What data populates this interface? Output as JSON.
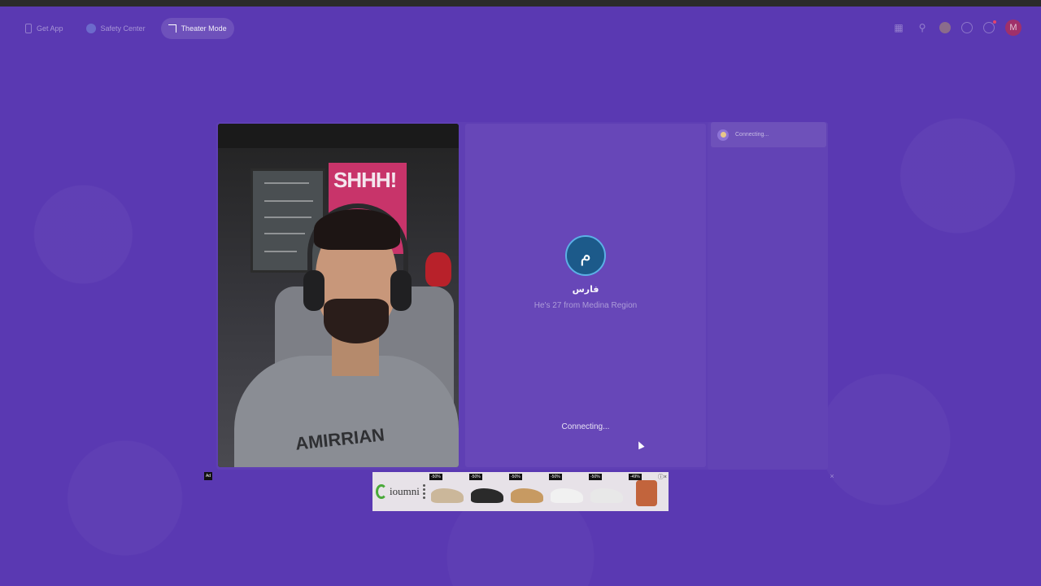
{
  "nav": {
    "get_app": "Get App",
    "safety_center": "Safety Center",
    "theater_mode": "Theater Mode"
  },
  "topright": {
    "icons": [
      "shop-icon",
      "search-icon",
      "coin-icon",
      "history-icon",
      "settings-icon"
    ],
    "avatar_letter": "M"
  },
  "chat": {
    "status": "Connecting..."
  },
  "partner": {
    "avatar_letter": "م",
    "name": "فارس",
    "info": "He's 27 from Medina Region",
    "connecting": "Connecting..."
  },
  "video": {
    "poster_text": "SHHH!",
    "hoodie_text": "AMIRRIAN"
  },
  "ad": {
    "label": "Ad",
    "brand": "ioumni",
    "products": [
      {
        "discount": "-50%",
        "color": "#cbb79a"
      },
      {
        "discount": "-50%",
        "color": "#2a2a2a"
      },
      {
        "discount": "-50%",
        "color": "#c79a62"
      },
      {
        "discount": "-50%",
        "color": "#f1f1f1"
      },
      {
        "discount": "-50%",
        "color": "#e8e8e8"
      },
      {
        "discount": "-49%",
        "color": "#c2643c"
      }
    ]
  },
  "colors": {
    "background": "#5a39b2",
    "avatar_bg": "#1c5a8a",
    "user_avatar": "#a0306a"
  }
}
